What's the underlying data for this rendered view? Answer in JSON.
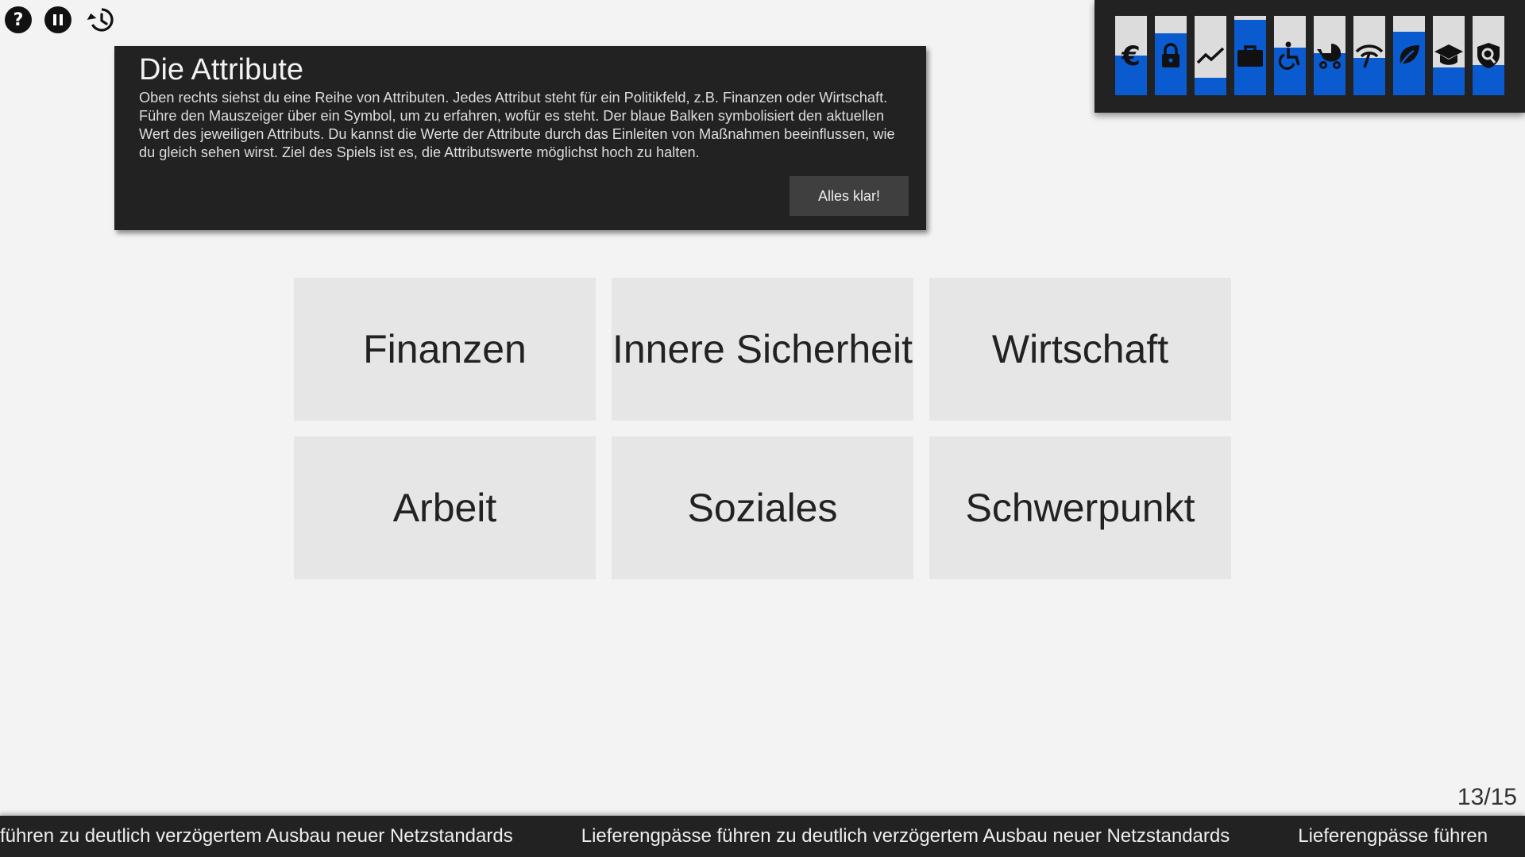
{
  "toolbar": {
    "help_label": "?",
    "help_icon": "help-icon",
    "pause_icon": "pause-icon",
    "history_icon": "history-icon"
  },
  "tooltip": {
    "title": "Die Attribute",
    "text": "Oben rechts siehst du eine Reihe von Attributen. Jedes Attribut steht für ein Politikfeld, z.B. Finanzen oder Wirtschaft. Führe den Mauszeiger über ein Symbol, um zu erfahren, wofür es steht. Der blaue Balken symbolisiert den aktuellen Wert des jeweiligen Attributs. Du kannst die Werte der Attribute durch das Einleiten von Maßnahmen beeinflussen, wie du gleich sehen wirst. Ziel des Spiels ist es, die Attributswerte möglichst hoch zu halten.",
    "ok_label": "Alles klar!"
  },
  "attributes": [
    {
      "icon": "euro-icon",
      "value": 0.5
    },
    {
      "icon": "lock-icon",
      "value": 0.78
    },
    {
      "icon": "trend-icon",
      "value": 0.22
    },
    {
      "icon": "briefcase-icon",
      "value": 0.95
    },
    {
      "icon": "accessible-icon",
      "value": 0.6
    },
    {
      "icon": "stroller-icon",
      "value": 0.53
    },
    {
      "icon": "network-icon",
      "value": 0.47
    },
    {
      "icon": "leaf-icon",
      "value": 0.8
    },
    {
      "icon": "graduation-cap-icon",
      "value": 0.35
    },
    {
      "icon": "security-shield-icon",
      "value": 0.38
    }
  ],
  "categories": [
    "Finanzen",
    "Innere Sicherheit",
    "Wirtschaft",
    "Arbeit",
    "Soziales",
    "Schwerpunkt"
  ],
  "progress": "13/15",
  "ticker": {
    "items": [
      "führen zu deutlich verzögertem Ausbau neuer Netzstandards",
      "Lieferengpässe führen zu deutlich verzögertem Ausbau neuer Netzstandards",
      "Lieferengpässe führen"
    ]
  },
  "colors": {
    "accent_blue": "#0a5bd0",
    "panel_dark": "#222222",
    "tile_bg": "#e6e6e6",
    "page_bg": "#f3f3f3"
  }
}
